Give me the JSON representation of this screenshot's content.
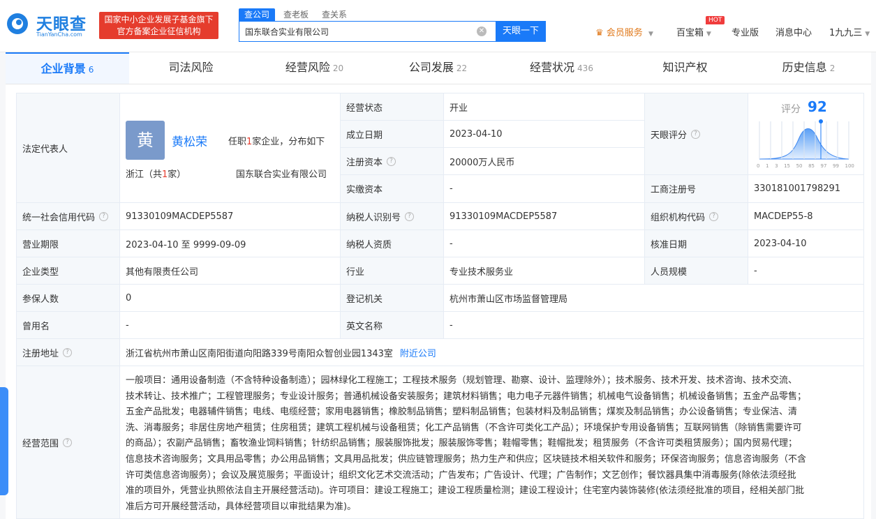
{
  "header": {
    "logo_cn": "天眼查",
    "logo_en": "TianYanCha.com",
    "banner_line1": "国家中小企业发展子基金旗下",
    "banner_line2": "官方备案企业征信机构",
    "search_tabs": [
      "查公司",
      "查老板",
      "查关系"
    ],
    "search_value": "国东联合实业有限公司",
    "search_button": "天眼一下",
    "nav": {
      "vip": "会员服务",
      "toolbox": "百宝箱",
      "hot": "HOT",
      "pro": "专业版",
      "messages": "消息中心",
      "user": "1九九三"
    }
  },
  "tabs": [
    {
      "label": "企业背景",
      "count": "6"
    },
    {
      "label": "司法风险",
      "count": ""
    },
    {
      "label": "经营风险",
      "count": "20"
    },
    {
      "label": "公司发展",
      "count": "22"
    },
    {
      "label": "经营状况",
      "count": "436"
    },
    {
      "label": "知识产权",
      "count": ""
    },
    {
      "label": "历史信息",
      "count": "2"
    }
  ],
  "info": {
    "legal_rep_label": "法定代表人",
    "avatar_char": "黄",
    "legal_rep_name": "黄松荣",
    "legal_rep_pos_pre": "任职",
    "legal_rep_pos_num": "1",
    "legal_rep_pos_post": "家企业，分布如下",
    "legal_rep_region_pre": "浙江（共",
    "legal_rep_region_num": "1",
    "legal_rep_region_post": "家）",
    "legal_rep_company": "国东联合实业有限公司",
    "status_label": "经营状态",
    "status_value": "开业",
    "founded_label": "成立日期",
    "founded_value": "2023-04-10",
    "capital_label": "注册资本",
    "capital_value": "20000万人民币",
    "paid_label": "实缴资本",
    "paid_value": "-",
    "score_label": "天眼评分",
    "score_title": "评分",
    "score_value": "92",
    "score_ticks": [
      "0",
      "1",
      "3",
      "15",
      "50",
      "85",
      "97",
      "99",
      "100"
    ],
    "regno_label": "工商注册号",
    "regno_value": "330181001798291",
    "uscc_label": "统一社会信用代码",
    "uscc_value": "91330109MACDEP5587",
    "taxid_label": "纳税人识别号",
    "taxid_value": "91330109MACDEP5587",
    "orgcode_label": "组织机构代码",
    "orgcode_value": "MACDEP55-8",
    "term_label": "营业期限",
    "term_value": "2023-04-10 至 9999-09-09",
    "taxq_label": "纳税人资质",
    "taxq_value": "-",
    "approve_label": "核准日期",
    "approve_value": "2023-04-10",
    "type_label": "企业类型",
    "type_value": "其他有限责任公司",
    "industry_label": "行业",
    "industry_value": "专业技术服务业",
    "staff_label": "人员规模",
    "staff_value": "-",
    "insured_label": "参保人数",
    "insured_value": "0",
    "authority_label": "登记机关",
    "authority_value": "杭州市萧山区市场监督管理局",
    "formername_label": "曾用名",
    "formername_value": "-",
    "english_label": "英文名称",
    "english_value": "-",
    "address_label": "注册地址",
    "address_value": "浙江省杭州市萧山区南阳街道向阳路339号南阳众智创业园1343室",
    "nearby": "附近公司",
    "scope_label": "经营范围",
    "scope_lines": [
      "一般项目：通用设备制造（不含特种设备制造）；园林绿化工程施工；工程技术服务（规划管理、勘察、设计、监理除外）；技术服务、技术开发、技术咨询、技术交流、",
      "技术转让、技术推广；工程管理服务；专业设计服务；普通机械设备安装服务；建筑材料销售；电力电子元器件销售；机械电气设备销售；机械设备销售；五金产品零售；",
      "五金产品批发；电器辅件销售；电线、电缆经营；家用电器销售；橡胶制品销售；塑料制品销售；包装材料及制品销售；煤炭及制品销售；办公设备销售；专业保洁、清",
      "洗、消毒服务；非居住房地产租赁；住房租赁；建筑工程机械与设备租赁；化工产品销售（不含许可类化工产品）；环境保护专用设备销售；互联网销售（除销售需要许可",
      "的商品）；农副产品销售；畜牧渔业饲料销售；针纺织品销售；服装服饰批发；服装服饰零售；鞋帽零售；鞋帽批发；租赁服务（不含许可类租赁服务）；国内贸易代理；",
      "信息技术咨询服务；文具用品零售；办公用品销售；文具用品批发；供应链管理服务；热力生产和供应；区块链技术相关软件和服务；环保咨询服务；信息咨询服务（不含",
      "许可类信息咨询服务）；会议及展览服务；平面设计；组织文化艺术交流活动；广告发布；广告设计、代理；广告制作；文艺创作；餐饮器具集中消毒服务(除依法须经批",
      "准的项目外，凭营业执照依法自主开展经营活动)。许可项目：建设工程施工；建设工程质量检测；建设工程设计；住宅室内装饰装修(依法须经批准的项目，经相关部门批",
      "准后方可开展经营活动，具体经营项目以审批结果为准)。"
    ]
  },
  "colors": {
    "brand": "#1a7af8",
    "banner": "#e53c2d",
    "vip": "#e0781a"
  }
}
